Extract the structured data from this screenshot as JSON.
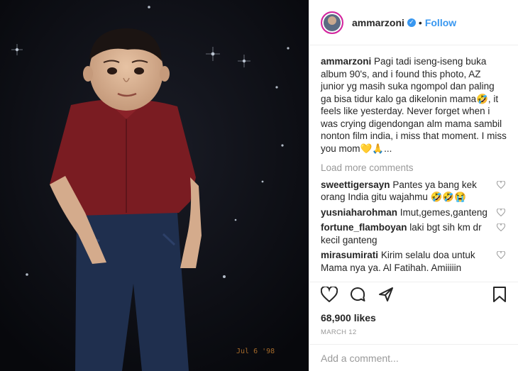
{
  "header": {
    "username": "ammarzoni",
    "separator": "•",
    "follow_label": "Follow"
  },
  "caption": {
    "author": "ammarzoni",
    "text": "Pagi tadi iseng-iseng buka album 90's, and i found this photo, AZ junior yg masih suka ngompol dan paling ga bisa tidur kalo ga dikelonin mama🤣, it feels like yesterday. Never forget when i was crying digendongan alm mama sambil nonton film india, i miss that moment. I miss you mom💛🙏..."
  },
  "load_more_label": "Load more comments",
  "comments": [
    {
      "author": "sweettigersayn",
      "text": "Pantes ya bang kek orang India gitu wajahmu 🤣🤣😭"
    },
    {
      "author": "yusniaharohman",
      "text": "Imut,gemes,ganteng"
    },
    {
      "author": "fortune_flamboyan",
      "text": "laki bgt sih km dr kecil ganteng"
    },
    {
      "author": "mirasumirati",
      "text": "Kirim selalu doa untuk Mama nya ya. Al Fatihah. Amiiiiin"
    }
  ],
  "likes": "68,900 likes",
  "date": "MARCH 12",
  "add_comment_placeholder": "Add a comment...",
  "photo": {
    "date_stamp": "Jul 6 '98"
  },
  "colors": {
    "accent": "#3897f0",
    "shirt": "#7a1c22",
    "jeans": "#1f2f4e",
    "background": "#0b0c12"
  },
  "icons": [
    "heart-icon",
    "comment-icon",
    "share-icon",
    "bookmark-icon",
    "verified-icon"
  ]
}
